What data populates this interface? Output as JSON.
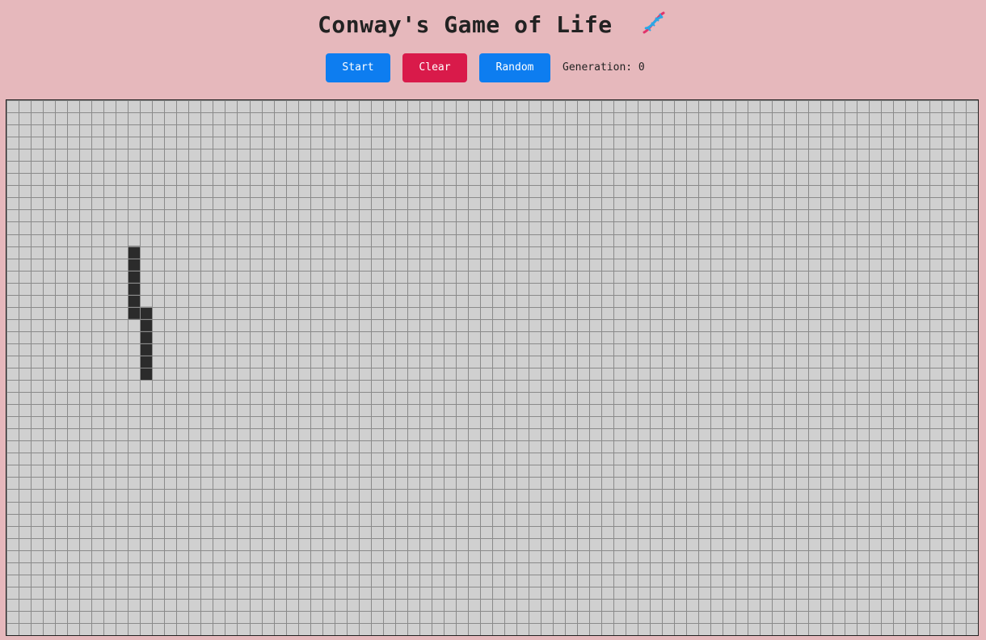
{
  "title": "Conway's Game of Life",
  "title_icon": "dna-icon",
  "controls": {
    "start_label": "Start",
    "clear_label": "Clear",
    "random_label": "Random",
    "generation_label": "Generation: 0"
  },
  "colors": {
    "background": "#e6b8bc",
    "dead_cell": "#d0d0d0",
    "live_cell": "#2b2b2b",
    "grid_line": "#8a8a8a",
    "start_button": "#0d7df0",
    "clear_button": "#d91a4a",
    "random_button": "#0d7df0"
  },
  "board": {
    "cols": 80,
    "rows": 44,
    "generation": 0,
    "live_cells": [
      [
        10,
        12
      ],
      [
        10,
        13
      ],
      [
        10,
        14
      ],
      [
        10,
        15
      ],
      [
        10,
        16
      ],
      [
        10,
        17
      ],
      [
        11,
        17
      ],
      [
        11,
        18
      ],
      [
        11,
        19
      ],
      [
        11,
        20
      ],
      [
        11,
        21
      ],
      [
        11,
        22
      ]
    ]
  }
}
